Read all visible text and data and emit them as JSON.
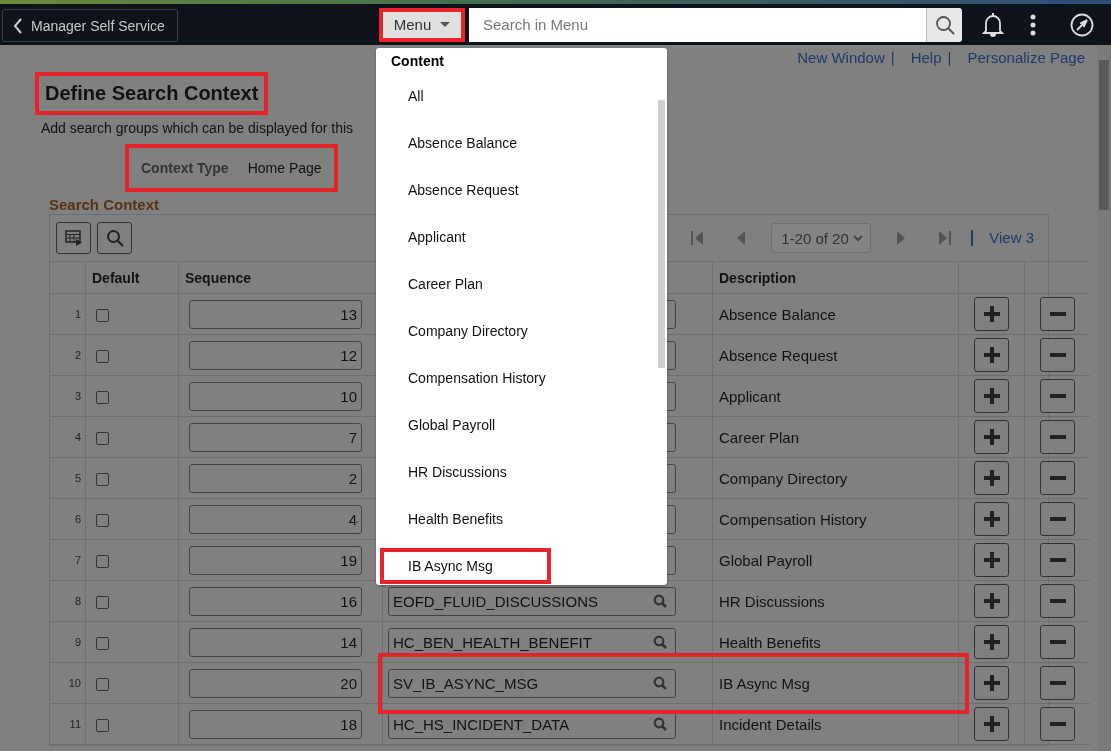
{
  "header": {
    "back_button": "Manager Self Service",
    "menu_button": {
      "label": "Menu",
      "highlighted": true
    },
    "search": {
      "placeholder": "Search in Menu"
    }
  },
  "menu_dropdown": {
    "heading": "Content",
    "items": [
      {
        "label": "All",
        "highlighted": false
      },
      {
        "label": "Absence Balance",
        "highlighted": false
      },
      {
        "label": "Absence Request",
        "highlighted": false
      },
      {
        "label": "Applicant",
        "highlighted": false
      },
      {
        "label": "Career Plan",
        "highlighted": false
      },
      {
        "label": "Company Directory",
        "highlighted": false
      },
      {
        "label": "Compensation History",
        "highlighted": false
      },
      {
        "label": "Global Payroll",
        "highlighted": false
      },
      {
        "label": "HR Discussions",
        "highlighted": false
      },
      {
        "label": "Health Benefits",
        "highlighted": false
      },
      {
        "label": "IB Async Msg",
        "highlighted": true
      }
    ]
  },
  "links": [
    {
      "label": "New Window",
      "separator": "|"
    },
    {
      "label": "Help",
      "separator": "|"
    },
    {
      "label": "Personalize Page"
    }
  ],
  "page": {
    "title": {
      "text": "Define Search Context",
      "highlighted": true
    },
    "description": "Add search groups which can be displayed for this",
    "context": {
      "label": "Context Type",
      "value": "Home Page",
      "highlighted": true
    }
  },
  "grid": {
    "title": "Search Context",
    "pager": {
      "range": "1-20 of 20",
      "view": "View 3"
    },
    "columns": {
      "default": "Default",
      "sequence": "Sequence",
      "description": "Description"
    },
    "rows": [
      {
        "number": "1",
        "default": false,
        "sequence": "13",
        "description": "Absence Balance",
        "highlighted": false
      },
      {
        "number": "2",
        "default": false,
        "sequence": "12",
        "description": "Absence Request",
        "highlighted": false
      },
      {
        "number": "3",
        "default": false,
        "sequence": "10",
        "description": "Applicant",
        "highlighted": false
      },
      {
        "number": "4",
        "default": false,
        "sequence": "7",
        "description": "Career Plan",
        "highlighted": false
      },
      {
        "number": "5",
        "default": false,
        "sequence": "2",
        "description": "Company Directory",
        "highlighted": false
      },
      {
        "number": "6",
        "default": false,
        "sequence": "4",
        "description": "Compensation History",
        "highlighted": false
      },
      {
        "number": "7",
        "default": false,
        "sequence": "19",
        "description": "Global Payroll",
        "highlighted": false
      },
      {
        "number": "8",
        "default": false,
        "sequence": "16",
        "id": "EOFD_FLUID_DISCUSSIONS",
        "description": "HR Discussions",
        "highlighted": false
      },
      {
        "number": "9",
        "default": false,
        "sequence": "14",
        "id": "HC_BEN_HEALTH_BENEFIT",
        "description": "Health Benefits",
        "highlighted": false
      },
      {
        "number": "10",
        "default": false,
        "sequence": "20",
        "id": "SV_IB_ASYNC_MSG",
        "description": "IB Async Msg",
        "highlighted": true
      },
      {
        "number": "11",
        "default": false,
        "sequence": "18",
        "id": "HC_HS_INCIDENT_DATA",
        "description": "Incident Details",
        "highlighted": false
      }
    ]
  }
}
